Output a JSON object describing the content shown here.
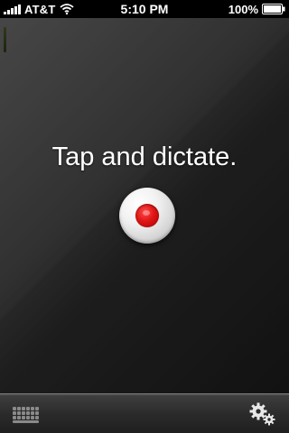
{
  "status_bar": {
    "carrier": "AT&T",
    "time": "5:10 PM",
    "battery": "100%"
  },
  "main": {
    "prompt": "Tap and dictate."
  },
  "icons": {
    "signal": "signal-bars-icon",
    "wifi": "wifi-icon",
    "battery": "battery-icon",
    "record": "record-icon",
    "keyboard": "keyboard-icon",
    "settings": "gears-icon"
  },
  "colors": {
    "record_red": "#e01515",
    "background_dark": "#1e1e1e",
    "text": "#ffffff"
  }
}
